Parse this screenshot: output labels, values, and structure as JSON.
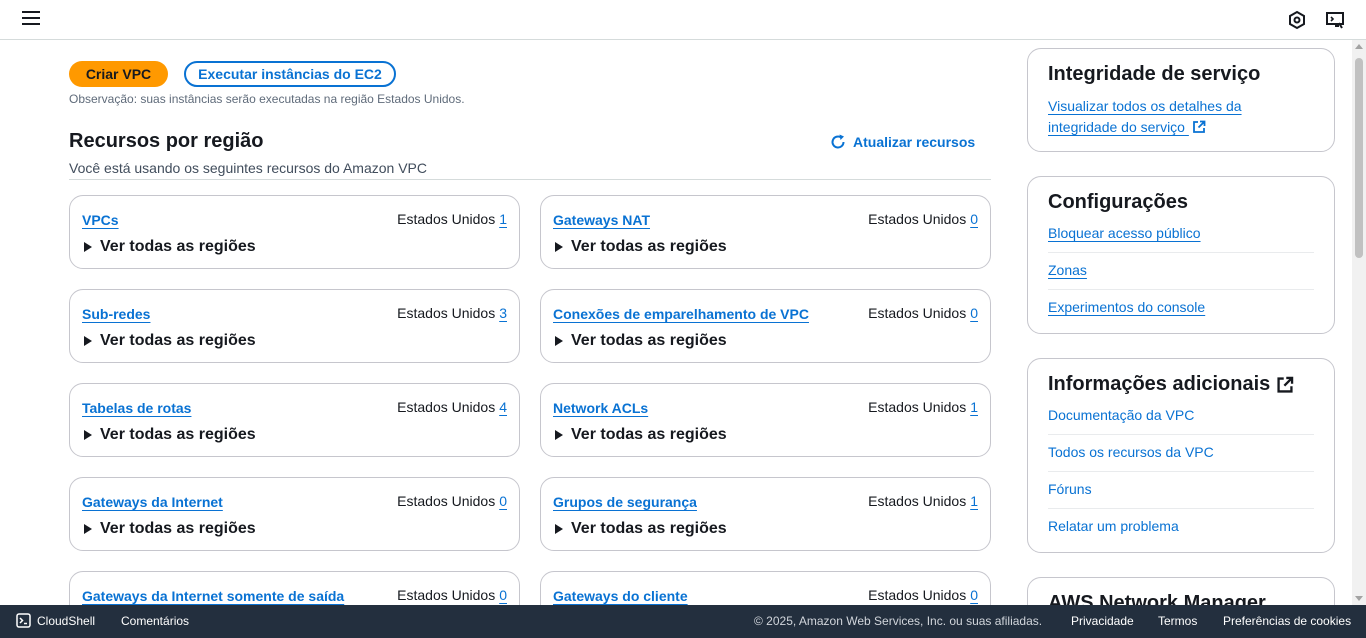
{
  "header": {
    "menu_icon": "hamburger-menu-icon",
    "icons": [
      "settings-hexagon-icon",
      "cloudshell-screen-icon"
    ]
  },
  "actions": {
    "create_vpc": "Criar VPC",
    "run_ec2": "Executar instâncias do EC2",
    "note": "Observação: suas instâncias serão executadas na região Estados Unidos."
  },
  "resources": {
    "title": "Recursos por região",
    "refresh": "Atualizar recursos",
    "description": "Você está usando os seguintes recursos do Amazon VPC",
    "expand_label": "Ver todas as regiões",
    "region_label": "Estados Unidos",
    "cards": [
      {
        "name": "VPCs",
        "count": "1"
      },
      {
        "name": "Gateways NAT",
        "count": "0"
      },
      {
        "name": "Sub-redes",
        "count": "3"
      },
      {
        "name": "Conexões de emparelhamento de VPC",
        "count": "0"
      },
      {
        "name": "Tabelas de rotas",
        "count": "4"
      },
      {
        "name": "Network ACLs",
        "count": "1"
      },
      {
        "name": "Gateways da Internet",
        "count": "0"
      },
      {
        "name": "Grupos de segurança",
        "count": "1"
      },
      {
        "name": "Gateways da Internet somente de saída",
        "count": "0"
      },
      {
        "name": "Gateways do cliente",
        "count": "0"
      }
    ]
  },
  "sidebar": {
    "health": {
      "title": "Integridade de serviço",
      "link_line1": "Visualizar todos os detalhes da",
      "link_line2": "integridade do serviço"
    },
    "settings": {
      "title": "Configurações",
      "items": [
        "Bloquear acesso público",
        "Zonas",
        "Experimentos do console"
      ]
    },
    "info": {
      "title": "Informações adicionais",
      "items": [
        "Documentação da VPC",
        "Todos os recursos da VPC",
        "Fóruns",
        "Relatar um problema"
      ]
    },
    "network_manager": {
      "title": "AWS Network Manager"
    }
  },
  "footer": {
    "cloudshell": "CloudShell",
    "feedback": "Comentários",
    "copyright": "© 2025, Amazon Web Services, Inc. ou suas afiliadas.",
    "privacy": "Privacidade",
    "terms": "Termos",
    "cookies": "Preferências de cookies"
  },
  "colors": {
    "accent": "#0972d3",
    "primary_button": "#ff9900",
    "footer_bg": "#232f3e"
  }
}
